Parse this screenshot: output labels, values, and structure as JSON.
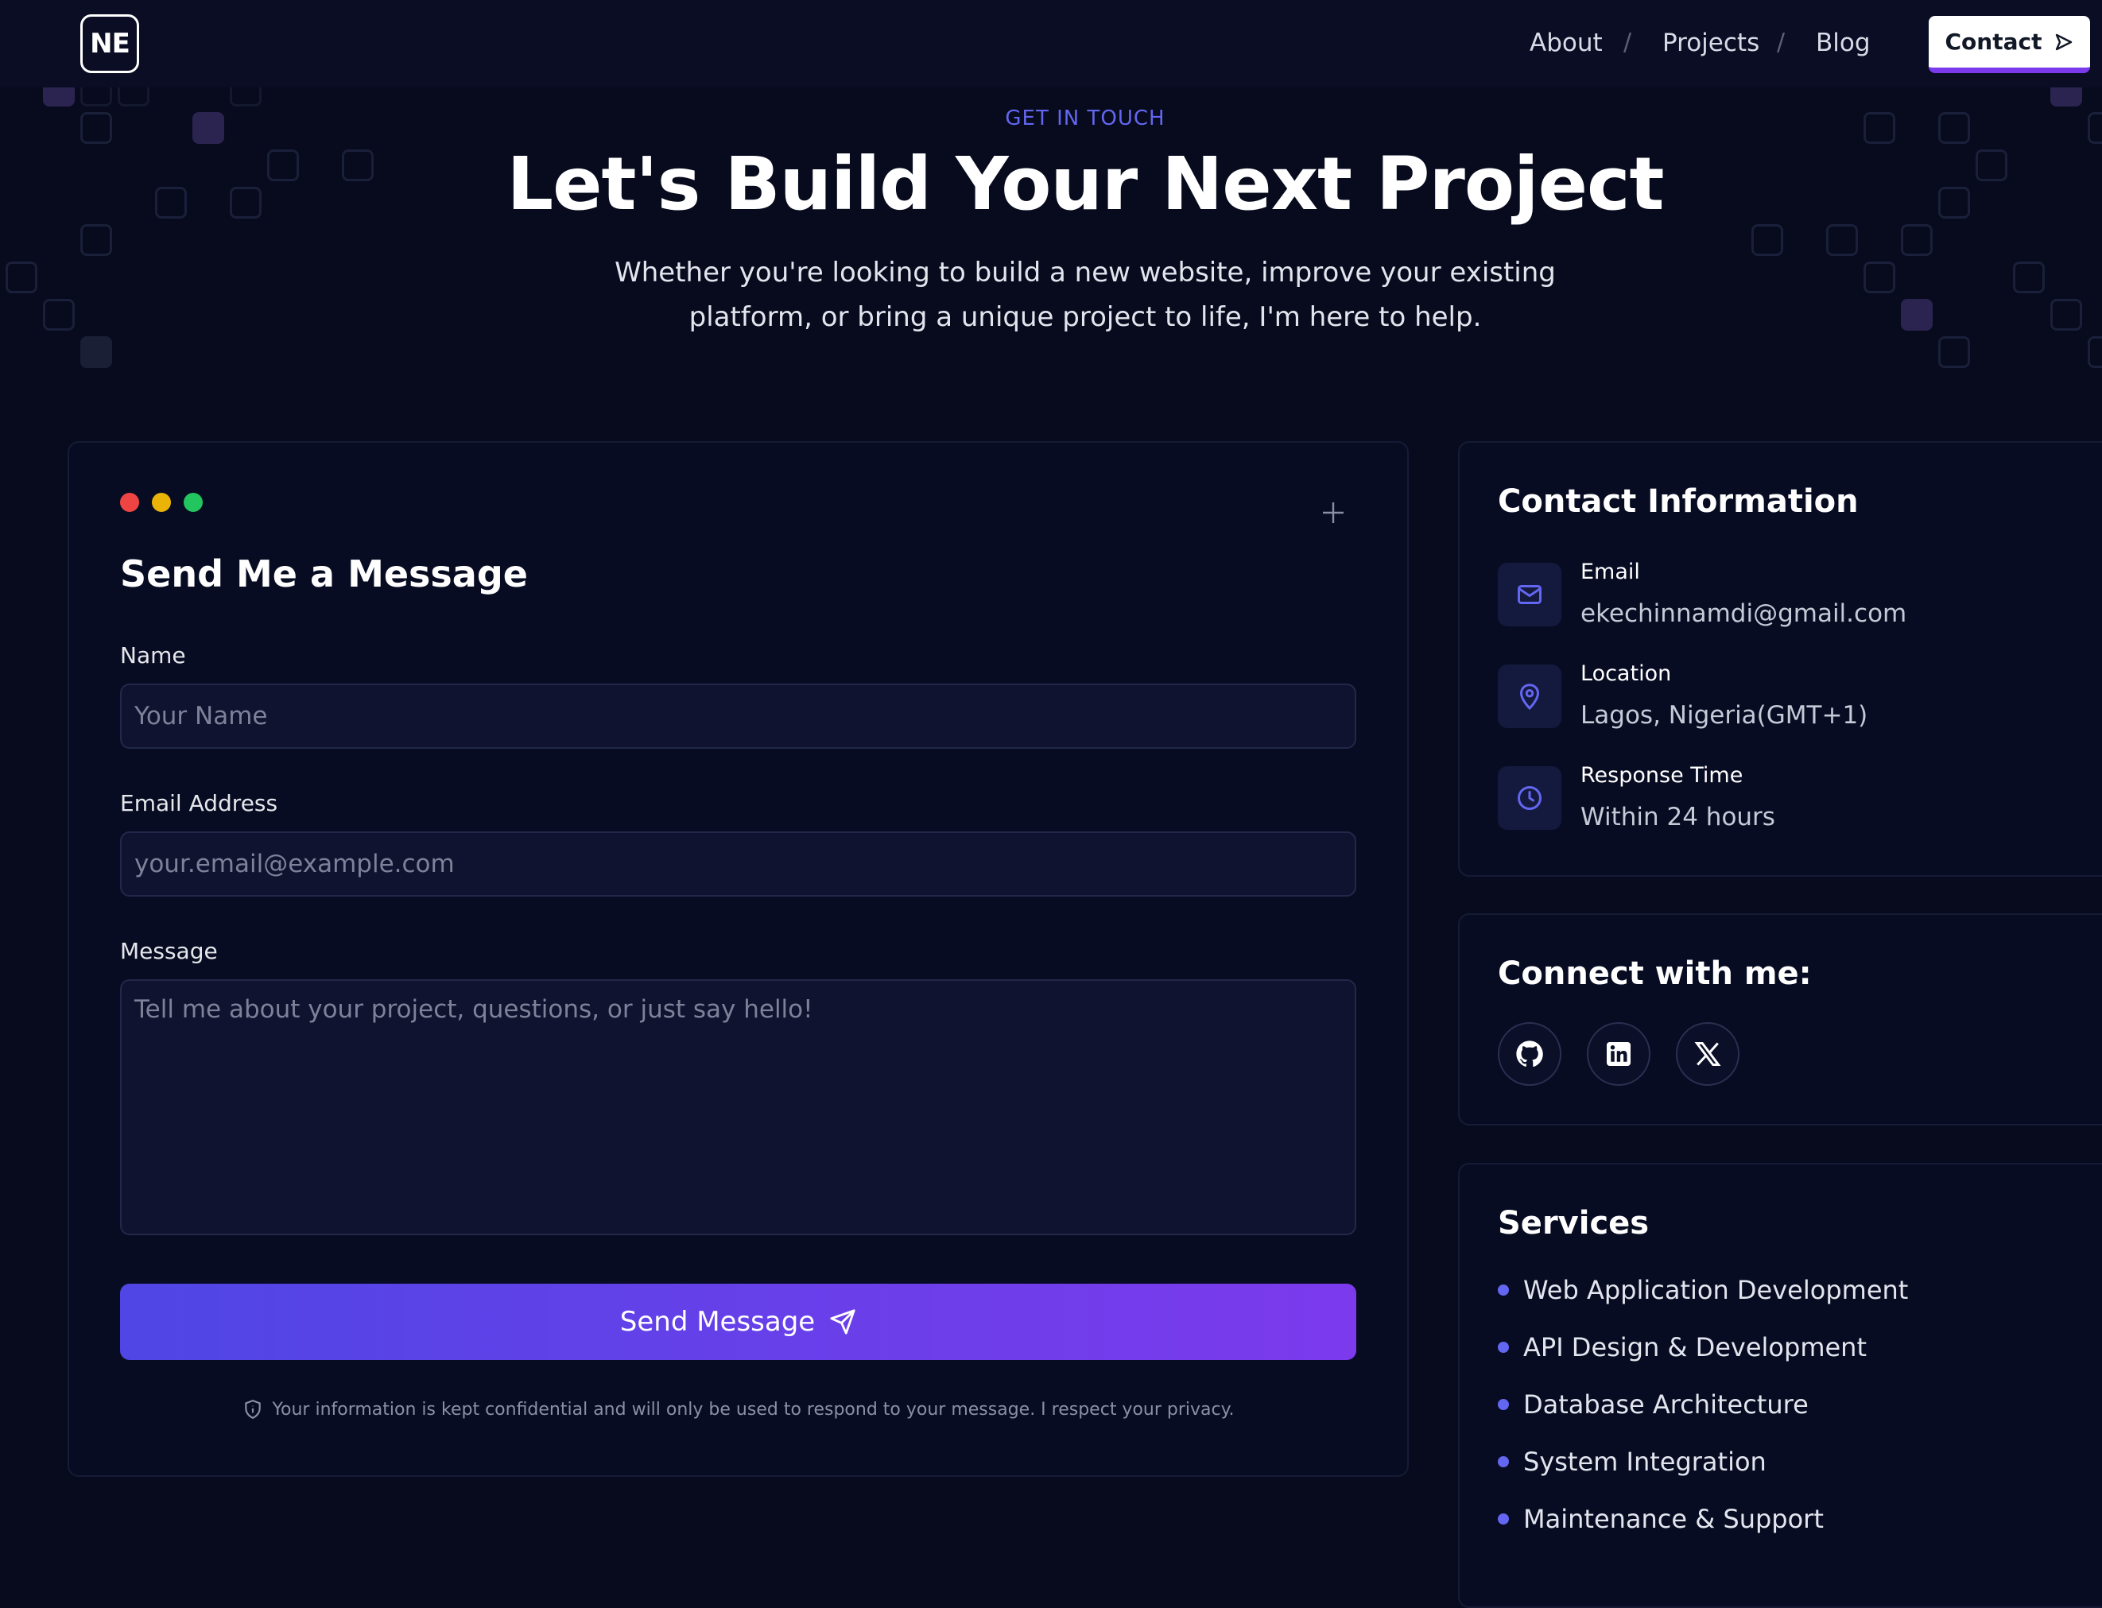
{
  "header": {
    "logo": "NE",
    "nav": [
      "About",
      "Projects",
      "Blog"
    ],
    "nav_separator": "/",
    "contact_label": "Contact"
  },
  "hero": {
    "eyebrow": "GET IN TOUCH",
    "title": "Let's Build Your Next Project",
    "subtitle": "Whether you're looking to build a new website, improve your existing platform, or bring a unique project to life, I'm here to help."
  },
  "form": {
    "title": "Send Me a Message",
    "window_dots": [
      "#ef4444",
      "#eab308",
      "#22c55e"
    ],
    "name_label": "Name",
    "name_placeholder": "Your Name",
    "email_label": "Email Address",
    "email_placeholder": "your.email@example.com",
    "message_label": "Message",
    "message_placeholder": "Tell me about your project, questions, or just say hello!",
    "submit_label": "Send Message",
    "privacy_note": "Your information is kept confidential and will only be used to respond to your message. I respect your privacy."
  },
  "contact_info": {
    "title": "Contact Information",
    "items": [
      {
        "icon": "mail-icon",
        "label": "Email",
        "value": "ekechinnamdi@gmail.com"
      },
      {
        "icon": "map-pin-icon",
        "label": "Location",
        "value": "Lagos, Nigeria(GMT+1)"
      },
      {
        "icon": "clock-icon",
        "label": "Response Time",
        "value": "Within 24 hours"
      }
    ]
  },
  "connect": {
    "title": "Connect with me:",
    "links": [
      "github-icon",
      "linkedin-icon",
      "x-icon"
    ]
  },
  "services": {
    "title": "Services",
    "items": [
      "Web Application Development",
      "API Design & Development",
      "Database Architecture",
      "System Integration",
      "Maintenance & Support"
    ]
  },
  "colors": {
    "background": "#070b1d",
    "accent": "#6366f1",
    "gradient_start": "#4f46e5",
    "gradient_end": "#7c3aed"
  }
}
